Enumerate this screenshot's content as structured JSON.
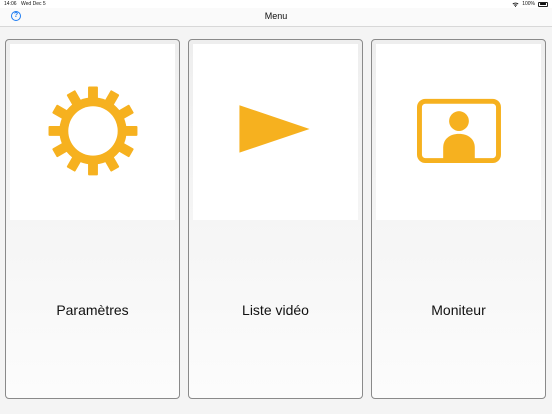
{
  "status_bar": {
    "time": "14:06",
    "date": "Wed Dec 5",
    "battery": "100%"
  },
  "nav": {
    "title": "Menu",
    "help_glyph": "?"
  },
  "tiles": [
    {
      "label": "Paramètres",
      "icon": "gear-icon"
    },
    {
      "label": "Liste vidéo",
      "icon": "play-icon"
    },
    {
      "label": "Moniteur",
      "icon": "monitor-person-icon"
    }
  ],
  "colors": {
    "accent": "#F6B11F",
    "ios_blue": "#1D7CF2"
  }
}
